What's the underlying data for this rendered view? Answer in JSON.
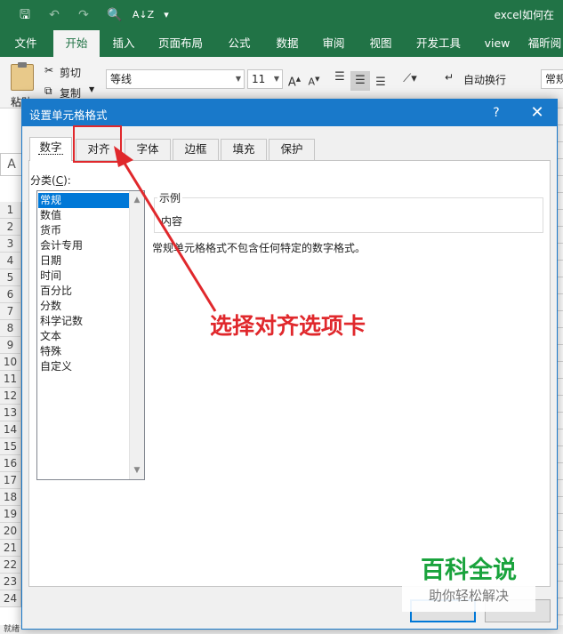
{
  "excel": {
    "quick_access": {
      "save": "🖫",
      "undo": "↶",
      "redo": "↷",
      "print_preview": "🔍",
      "sort": "A↓Z",
      "customize": "▾"
    },
    "doc_title": "excel如何在",
    "tabs": [
      "文件",
      "开始",
      "插入",
      "页面布局",
      "公式",
      "数据",
      "审阅",
      "视图",
      "开发工具",
      "view",
      "福昕阅"
    ],
    "active_tab": "开始",
    "ribbon": {
      "paste": "粘贴",
      "cut": "剪切",
      "copy": "复制",
      "font_name": "等线",
      "font_size": "11",
      "grow_font": "A",
      "shrink_font": "A",
      "wrap_text": "自动换行",
      "number_format": "常规"
    },
    "name_box": "A",
    "row_numbers": [
      "1",
      "2",
      "3",
      "4",
      "5",
      "6",
      "7",
      "8",
      "9",
      "10",
      "11",
      "12",
      "13",
      "14",
      "15",
      "16",
      "17",
      "18",
      "19",
      "20",
      "21",
      "22",
      "23",
      "24"
    ],
    "status_text": "就绪"
  },
  "dialog": {
    "title": "设置单元格格式",
    "help": "?",
    "close": "✕",
    "tabs": [
      "数字",
      "对齐",
      "字体",
      "边框",
      "填充",
      "保护"
    ],
    "active_tab": "数字",
    "category_label": "分类(",
    "category_accel": "C",
    "category_label_end": "):",
    "categories": [
      "常规",
      "数值",
      "货币",
      "会计专用",
      "日期",
      "时间",
      "百分比",
      "分数",
      "科学记数",
      "文本",
      "特殊",
      "自定义"
    ],
    "selected_category": "常规",
    "sample_label": "示例",
    "sample_value": "内容",
    "description": "常规单元格格式不包含任何特定的数字格式。"
  },
  "annotation": {
    "callout": "选择对齐选项卡",
    "color": "#e0282c"
  },
  "watermark": {
    "title": "百科全说",
    "subtitle": "助你轻松解决"
  },
  "colors": {
    "excel_green": "#217346",
    "dialog_blue": "#1979ca",
    "selection_blue": "#0078d7",
    "watermark_green": "#1aa33d"
  }
}
